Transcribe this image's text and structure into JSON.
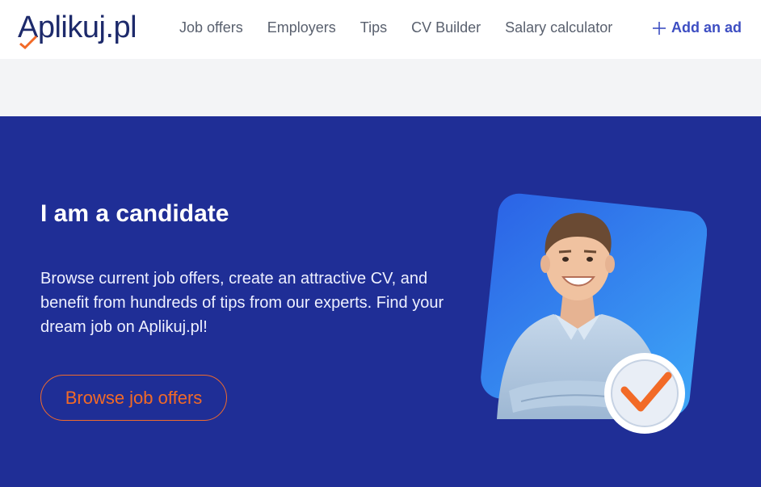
{
  "header": {
    "logo_text": "plikuj.pl",
    "logo_initial": "A",
    "nav": [
      "Job offers",
      "Employers",
      "Tips",
      "CV Builder",
      "Salary calculator"
    ],
    "add_ad_label": "Add an ad"
  },
  "hero": {
    "title": "I am a candidate",
    "text": "Browse current job offers, create an attractive CV, and benefit from hundreds of tips from our experts. Find your dream job on Aplikuj.pl!",
    "button_label": "Browse job offers"
  },
  "colors": {
    "brand_navy": "#1d2a6b",
    "accent_orange": "#f26a27",
    "hero_bg": "#1f2e96",
    "link_blue": "#3d4ec2"
  },
  "icons": [
    "logo-check-icon",
    "plus-icon",
    "checkmark-badge-icon"
  ]
}
